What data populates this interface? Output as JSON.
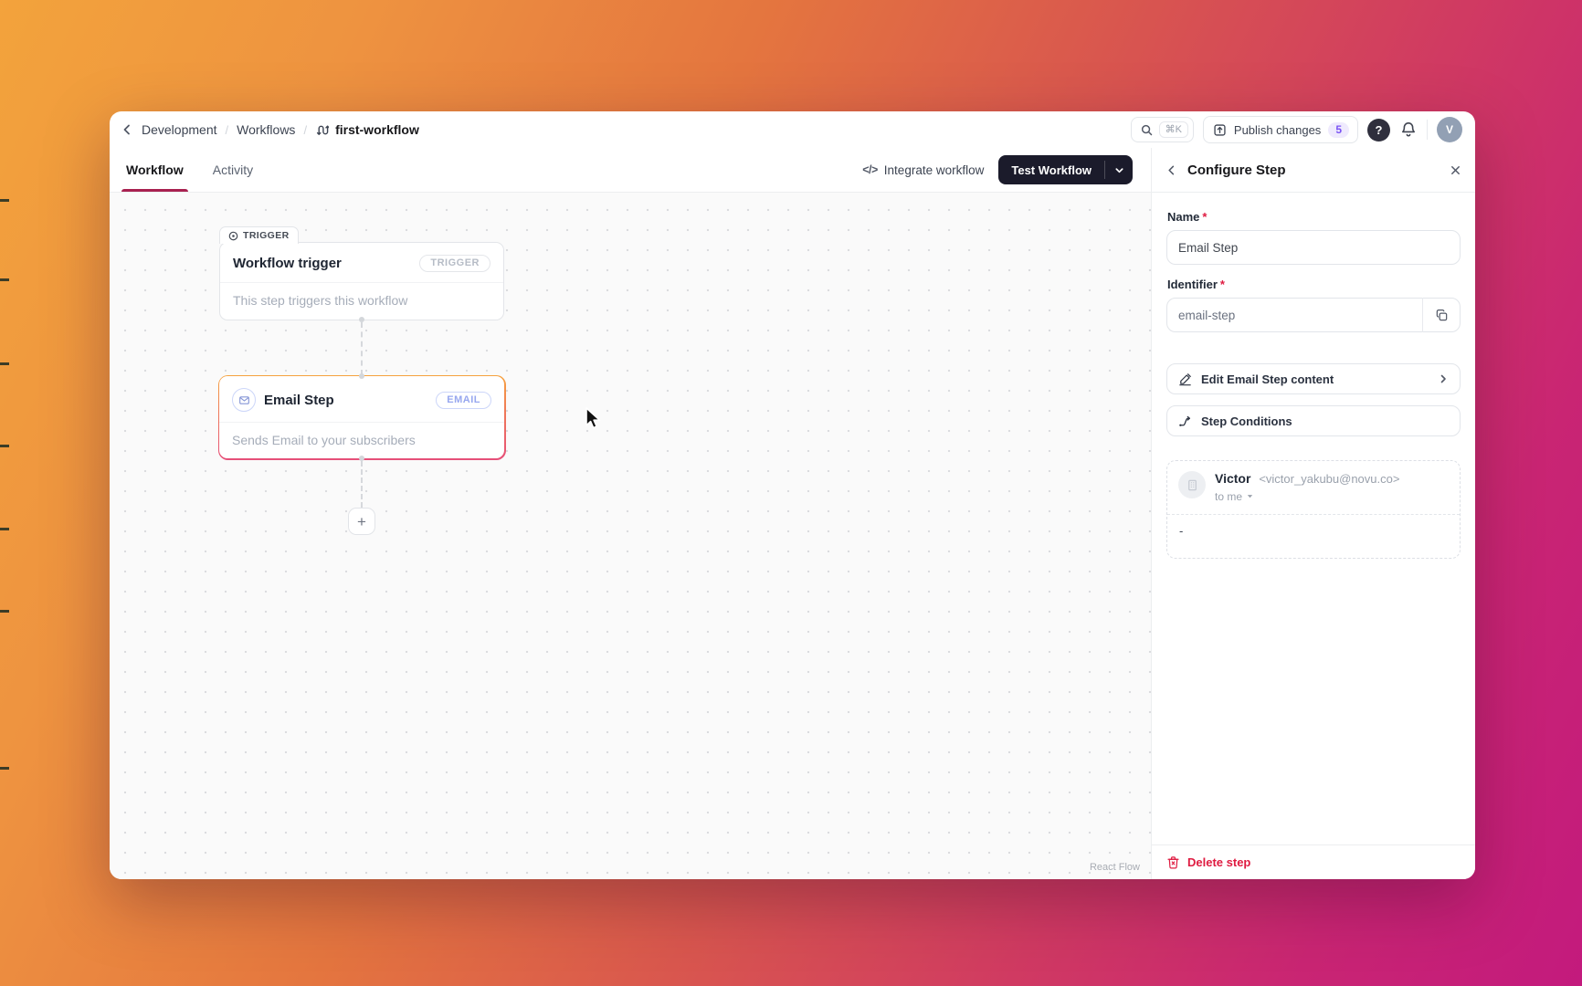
{
  "colors": {
    "accent_underline": "#a82150",
    "test_button_bg": "#1b1b2b",
    "badge_text": "#7a52f4",
    "delete_red": "#df1b41",
    "email_border_top": "#f6a23e",
    "email_border_bottom": "#e64f79"
  },
  "background": {
    "edge_tick_ys": [
      218,
      305,
      397,
      487,
      578,
      668,
      840
    ]
  },
  "header": {
    "breadcrumb": {
      "separator": "/",
      "items": [
        "Development",
        "Workflows"
      ],
      "current": "first-workflow"
    },
    "search_shortcut": "⌘K",
    "publish_label": "Publish changes",
    "publish_badge": "5",
    "help_glyph": "?",
    "avatar_initial": "V"
  },
  "tabs": {
    "workflow": "Workflow",
    "activity": "Activity"
  },
  "toolbar": {
    "integrate_icon": "</>",
    "integrate_label": "Integrate workflow",
    "test_label": "Test Workflow"
  },
  "canvas": {
    "trigger_tab_label": "TRIGGER",
    "trigger_node": {
      "title": "Workflow trigger",
      "badge": "TRIGGER",
      "description": "This step triggers this workflow"
    },
    "email_node": {
      "title": "Email Step",
      "badge": "EMAIL",
      "description": "Sends Email to your subscribers"
    },
    "add_button_glyph": "+",
    "attribution": "React Flow"
  },
  "panel": {
    "title": "Configure Step",
    "required_mark": "*",
    "name_label": "Name",
    "name_value": "Email Step",
    "identifier_label": "Identifier",
    "identifier_value": "email-step",
    "edit_content_label": "Edit Email Step content",
    "step_conditions_label": "Step Conditions",
    "preview": {
      "sender_name": "Victor",
      "sender_email": "<victor_yakubu@novu.co>",
      "recipient": "to me",
      "body_text": "-"
    },
    "delete_label": "Delete step"
  }
}
